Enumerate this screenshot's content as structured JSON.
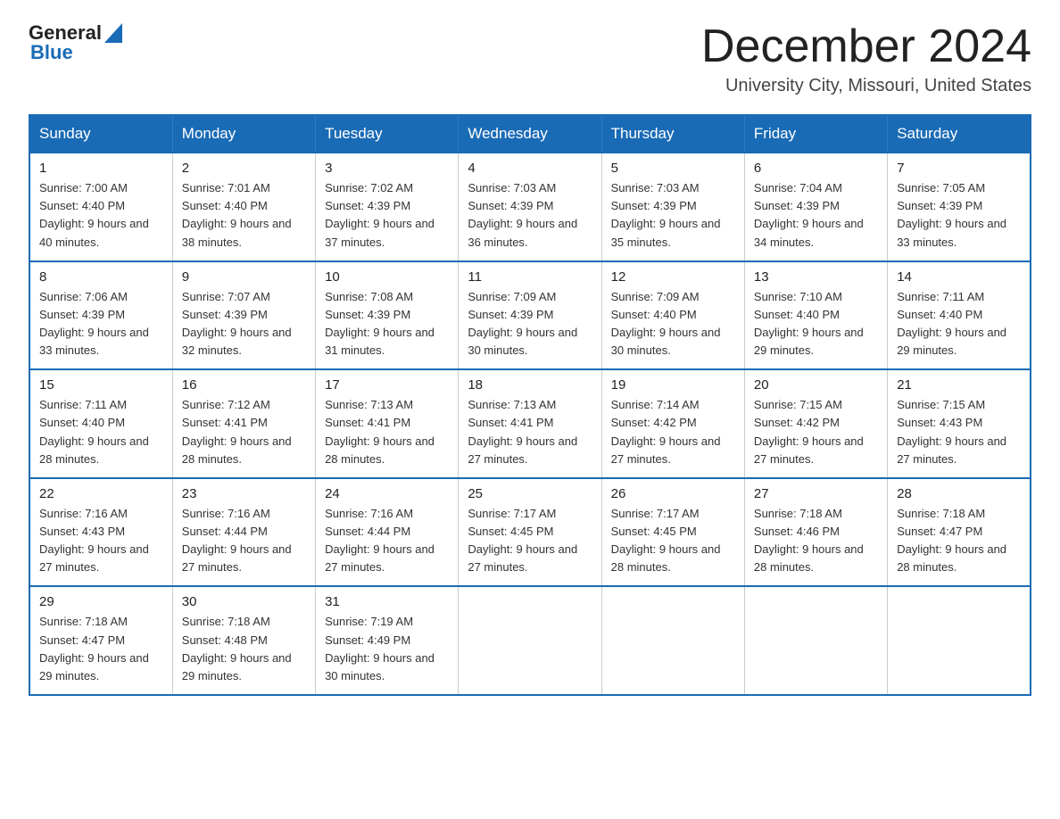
{
  "header": {
    "logo_general": "General",
    "logo_blue": "Blue",
    "title": "December 2024",
    "subtitle": "University City, Missouri, United States"
  },
  "calendar": {
    "days_of_week": [
      "Sunday",
      "Monday",
      "Tuesday",
      "Wednesday",
      "Thursday",
      "Friday",
      "Saturday"
    ],
    "weeks": [
      [
        {
          "day": "1",
          "sunrise": "7:00 AM",
          "sunset": "4:40 PM",
          "daylight": "9 hours and 40 minutes."
        },
        {
          "day": "2",
          "sunrise": "7:01 AM",
          "sunset": "4:40 PM",
          "daylight": "9 hours and 38 minutes."
        },
        {
          "day": "3",
          "sunrise": "7:02 AM",
          "sunset": "4:39 PM",
          "daylight": "9 hours and 37 minutes."
        },
        {
          "day": "4",
          "sunrise": "7:03 AM",
          "sunset": "4:39 PM",
          "daylight": "9 hours and 36 minutes."
        },
        {
          "day": "5",
          "sunrise": "7:03 AM",
          "sunset": "4:39 PM",
          "daylight": "9 hours and 35 minutes."
        },
        {
          "day": "6",
          "sunrise": "7:04 AM",
          "sunset": "4:39 PM",
          "daylight": "9 hours and 34 minutes."
        },
        {
          "day": "7",
          "sunrise": "7:05 AM",
          "sunset": "4:39 PM",
          "daylight": "9 hours and 33 minutes."
        }
      ],
      [
        {
          "day": "8",
          "sunrise": "7:06 AM",
          "sunset": "4:39 PM",
          "daylight": "9 hours and 33 minutes."
        },
        {
          "day": "9",
          "sunrise": "7:07 AM",
          "sunset": "4:39 PM",
          "daylight": "9 hours and 32 minutes."
        },
        {
          "day": "10",
          "sunrise": "7:08 AM",
          "sunset": "4:39 PM",
          "daylight": "9 hours and 31 minutes."
        },
        {
          "day": "11",
          "sunrise": "7:09 AM",
          "sunset": "4:39 PM",
          "daylight": "9 hours and 30 minutes."
        },
        {
          "day": "12",
          "sunrise": "7:09 AM",
          "sunset": "4:40 PM",
          "daylight": "9 hours and 30 minutes."
        },
        {
          "day": "13",
          "sunrise": "7:10 AM",
          "sunset": "4:40 PM",
          "daylight": "9 hours and 29 minutes."
        },
        {
          "day": "14",
          "sunrise": "7:11 AM",
          "sunset": "4:40 PM",
          "daylight": "9 hours and 29 minutes."
        }
      ],
      [
        {
          "day": "15",
          "sunrise": "7:11 AM",
          "sunset": "4:40 PM",
          "daylight": "9 hours and 28 minutes."
        },
        {
          "day": "16",
          "sunrise": "7:12 AM",
          "sunset": "4:41 PM",
          "daylight": "9 hours and 28 minutes."
        },
        {
          "day": "17",
          "sunrise": "7:13 AM",
          "sunset": "4:41 PM",
          "daylight": "9 hours and 28 minutes."
        },
        {
          "day": "18",
          "sunrise": "7:13 AM",
          "sunset": "4:41 PM",
          "daylight": "9 hours and 27 minutes."
        },
        {
          "day": "19",
          "sunrise": "7:14 AM",
          "sunset": "4:42 PM",
          "daylight": "9 hours and 27 minutes."
        },
        {
          "day": "20",
          "sunrise": "7:15 AM",
          "sunset": "4:42 PM",
          "daylight": "9 hours and 27 minutes."
        },
        {
          "day": "21",
          "sunrise": "7:15 AM",
          "sunset": "4:43 PM",
          "daylight": "9 hours and 27 minutes."
        }
      ],
      [
        {
          "day": "22",
          "sunrise": "7:16 AM",
          "sunset": "4:43 PM",
          "daylight": "9 hours and 27 minutes."
        },
        {
          "day": "23",
          "sunrise": "7:16 AM",
          "sunset": "4:44 PM",
          "daylight": "9 hours and 27 minutes."
        },
        {
          "day": "24",
          "sunrise": "7:16 AM",
          "sunset": "4:44 PM",
          "daylight": "9 hours and 27 minutes."
        },
        {
          "day": "25",
          "sunrise": "7:17 AM",
          "sunset": "4:45 PM",
          "daylight": "9 hours and 27 minutes."
        },
        {
          "day": "26",
          "sunrise": "7:17 AM",
          "sunset": "4:45 PM",
          "daylight": "9 hours and 28 minutes."
        },
        {
          "day": "27",
          "sunrise": "7:18 AM",
          "sunset": "4:46 PM",
          "daylight": "9 hours and 28 minutes."
        },
        {
          "day": "28",
          "sunrise": "7:18 AM",
          "sunset": "4:47 PM",
          "daylight": "9 hours and 28 minutes."
        }
      ],
      [
        {
          "day": "29",
          "sunrise": "7:18 AM",
          "sunset": "4:47 PM",
          "daylight": "9 hours and 29 minutes."
        },
        {
          "day": "30",
          "sunrise": "7:18 AM",
          "sunset": "4:48 PM",
          "daylight": "9 hours and 29 minutes."
        },
        {
          "day": "31",
          "sunrise": "7:19 AM",
          "sunset": "4:49 PM",
          "daylight": "9 hours and 30 minutes."
        },
        null,
        null,
        null,
        null
      ]
    ]
  }
}
